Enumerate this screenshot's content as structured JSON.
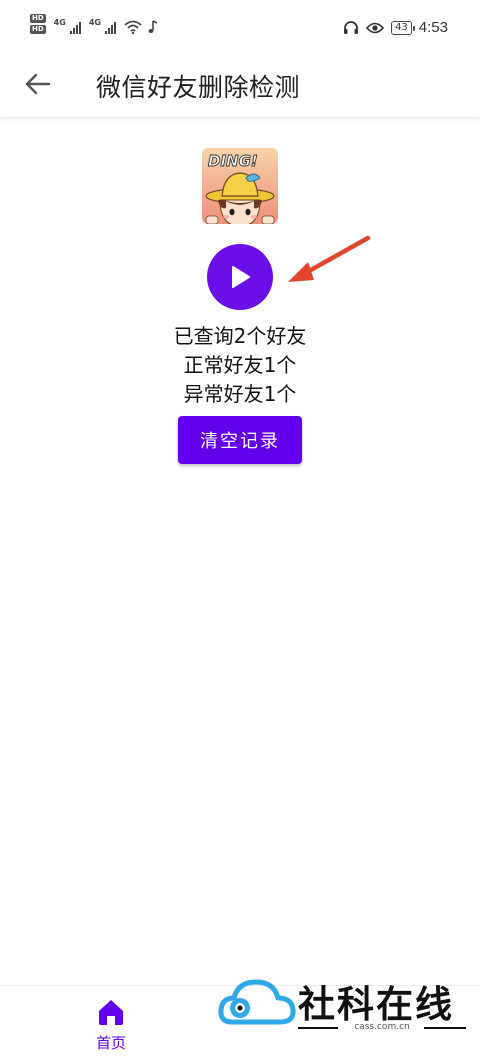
{
  "status_bar": {
    "hd_badge_1": "HD",
    "hd_badge_2": "HD",
    "network_1": "4G",
    "network_2": "4G",
    "battery_level": "43",
    "time": "4:53"
  },
  "app_bar": {
    "title": "微信好友删除检测"
  },
  "avatar": {
    "badge_text": "DING!"
  },
  "stats": {
    "queried": "已查询2个好友",
    "normal": "正常好友1个",
    "abnormal": "异常好友1个"
  },
  "buttons": {
    "clear_label": "清空记录"
  },
  "bottom_nav": {
    "home_label": "首页"
  },
  "watermark": {
    "brand": "社科在线",
    "url": "cass.com.cn"
  },
  "colors": {
    "accent": "#6200ee",
    "play": "#6a0fe8",
    "arrow": "#e0452e"
  }
}
